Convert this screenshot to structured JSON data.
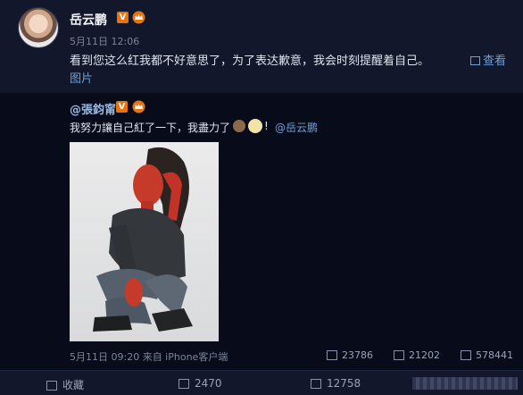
{
  "post": {
    "author": "岳云鹏",
    "verified_badge": "V",
    "time": "5月11日 12:06",
    "content": "看到您这么红我都不好意思了，为了表达歉意，我会时刻提醒着自己。",
    "view_image_label_line1": "查看",
    "view_image_label_line2": "图片"
  },
  "repost": {
    "author": "@張鈞甯",
    "verified_badge": "V",
    "content": "我努力讓自己紅了一下，我盡力了",
    "exclaim": "!",
    "mention": "@岳云鹏",
    "meta": "5月11日 09:20 来自 iPhone客户端",
    "stats": {
      "reposts": "23786",
      "comments": "21202",
      "likes": "578441"
    }
  },
  "footer": {
    "favorite_label": "收藏",
    "reposts": "2470",
    "comments": "12758"
  },
  "colors": {
    "accent": "#6f9fd6",
    "badge": "#e8720c",
    "background": "#0e1326"
  }
}
